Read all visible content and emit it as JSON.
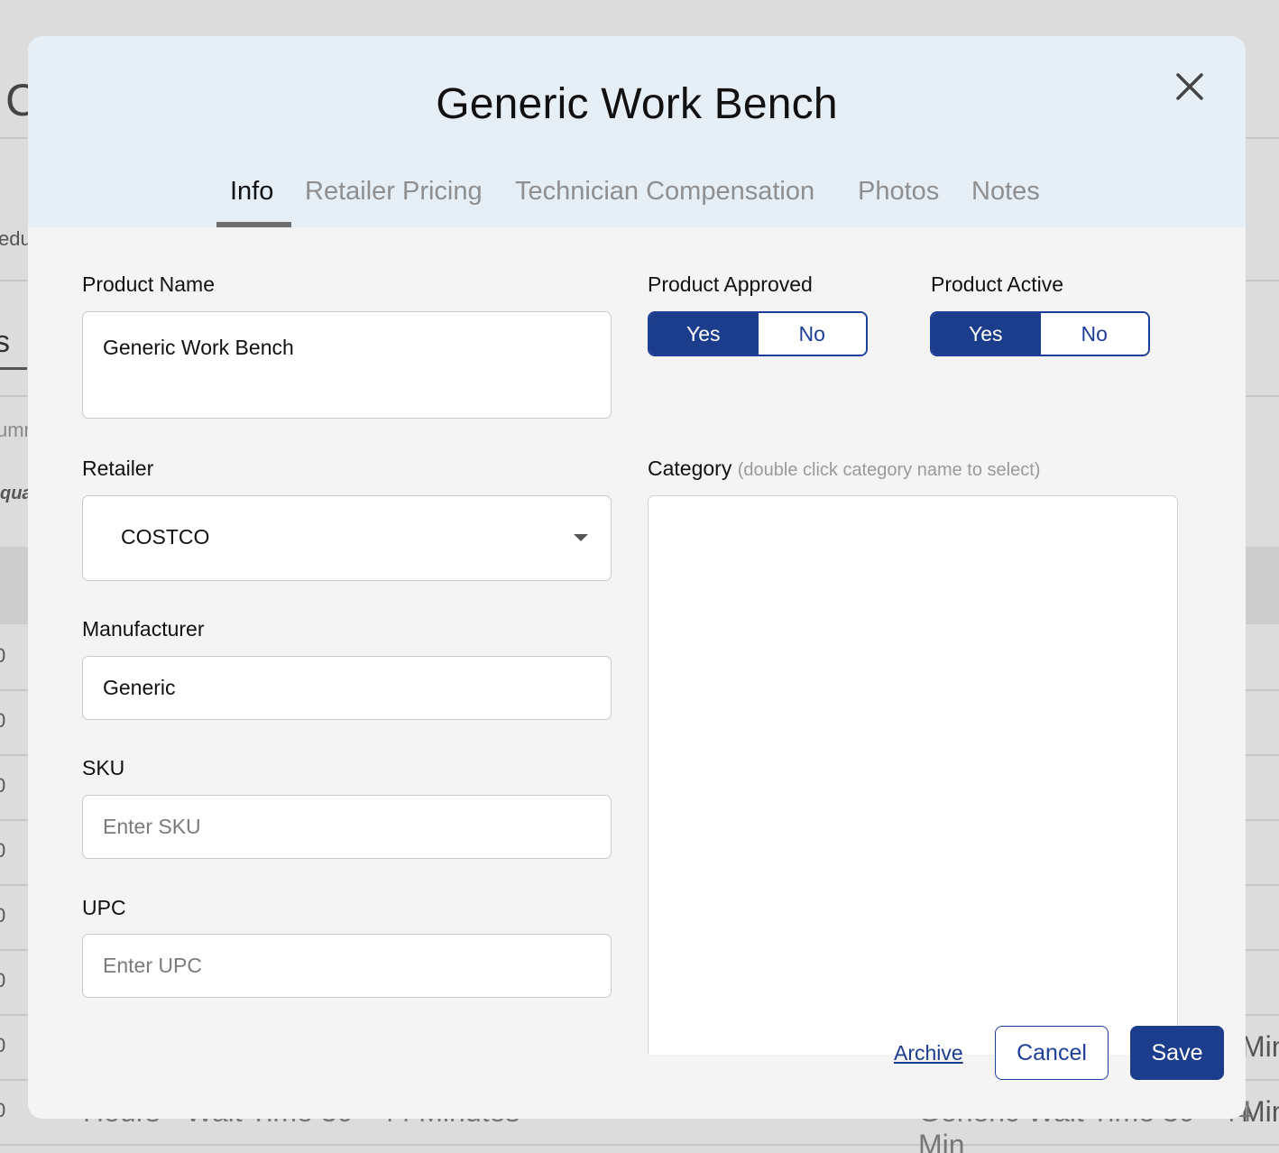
{
  "background": {
    "fragments": {
      "heading": "C",
      "schedule": "edu",
      "tab": "s",
      "summary": "umm",
      "quantity": "qua",
      "row_digit": "0",
      "minutes": "Min",
      "bottom_left": "Hours - Wait Time 30 - 44 Minutes",
      "bottom_right": "Generic Wait Time 30 - 44 Min"
    }
  },
  "modal": {
    "title": "Generic Work Bench",
    "close_icon": "close-x-icon",
    "tabs": [
      {
        "label": "Info",
        "active": true
      },
      {
        "label": "Retailer Pricing",
        "active": false
      },
      {
        "label": "Technician Compensation",
        "active": false
      },
      {
        "label": "Photos",
        "active": false
      },
      {
        "label": "Notes",
        "active": false
      }
    ],
    "form": {
      "product_name": {
        "label": "Product Name",
        "value": "Generic Work Bench"
      },
      "retailer": {
        "label": "Retailer",
        "value": "COSTCO",
        "icon": "caret-down-icon"
      },
      "manufacturer": {
        "label": "Manufacturer",
        "value": "Generic"
      },
      "sku": {
        "label": "SKU",
        "value": "",
        "placeholder": "Enter SKU"
      },
      "upc": {
        "label": "UPC",
        "value": "",
        "placeholder": "Enter UPC"
      },
      "product_approved": {
        "label": "Product Approved",
        "yes": "Yes",
        "no": "No",
        "selected": "Yes"
      },
      "product_active": {
        "label": "Product Active",
        "yes": "Yes",
        "no": "No",
        "selected": "Yes"
      },
      "category": {
        "label": "Category",
        "hint": "(double click category name to select)"
      }
    },
    "actions": {
      "archive": "Archive",
      "cancel": "Cancel",
      "save": "Save"
    }
  },
  "colors": {
    "primary": "#1c3c8c",
    "header_bg": "#e6eef6",
    "modal_bg": "#f4f4f4",
    "overlay_bg": "#dcdcdc"
  }
}
